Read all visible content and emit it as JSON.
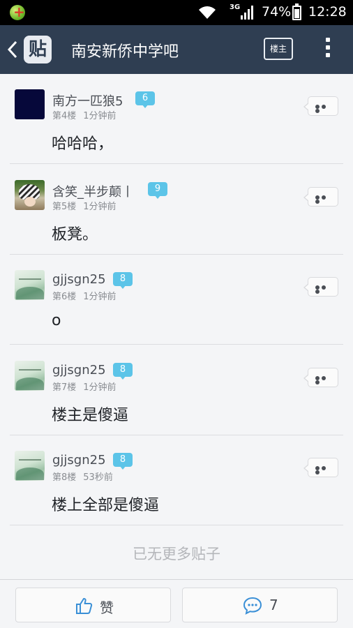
{
  "status_bar": {
    "network": "3G",
    "battery": "74%",
    "battery_level": 0.74,
    "time": "12:28",
    "icons": [
      "app-notification-icon",
      "wifi-icon",
      "signal-icon",
      "battery-icon"
    ]
  },
  "header": {
    "logo_char": "贴",
    "title": "南安新侨中学吧",
    "louzhu_label": "楼主"
  },
  "posts": [
    {
      "username": "南方一匹狼5",
      "level": "6",
      "floor": "第4楼",
      "time": "1分钟前",
      "content": "哈哈哈，",
      "avatar": "dark"
    },
    {
      "username": "含笑_半步颠丨",
      "level": "9",
      "floor": "第5楼",
      "time": "1分钟前",
      "content": "板凳。",
      "avatar": "anime"
    },
    {
      "username": "gjjsgn25",
      "level": "8",
      "floor": "第6楼",
      "time": "1分钟前",
      "content": "o",
      "avatar": "leaf"
    },
    {
      "username": "gjjsgn25",
      "level": "8",
      "floor": "第7楼",
      "time": "1分钟前",
      "content": "楼主是傻逼",
      "avatar": "leaf"
    },
    {
      "username": "gjjsgn25",
      "level": "8",
      "floor": "第8楼",
      "time": "53秒前",
      "content": "楼上全部是傻逼",
      "avatar": "leaf"
    }
  ],
  "list_footer": "已无更多贴子",
  "bottom_bar": {
    "like_label": "赞",
    "comment_count": "7"
  },
  "colors": {
    "header_bg": "#2f3e52",
    "level_badge": "#5cc4e8",
    "like_icon": "#3a8fd6"
  }
}
